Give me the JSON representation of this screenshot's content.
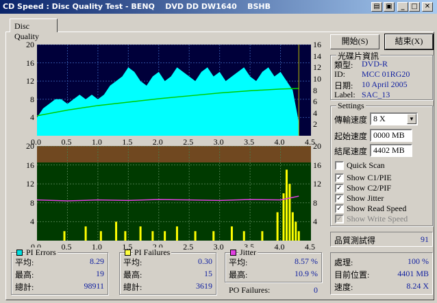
{
  "window": {
    "title": "CD Speed : Disc Quality Test - BENQ    DVD DD DW1640    BSHB"
  },
  "tab": {
    "label": "Disc Quality"
  },
  "buttons": {
    "start": "開始(S)",
    "stop": "結束(X)"
  },
  "disc_info": {
    "title": "光碟片資訊",
    "type_label": "類型:",
    "type_value": "DVD-R",
    "id_label": "ID:",
    "id_value": "MCC 01RG20",
    "date_label": "日期:",
    "date_value": "10 April 2005",
    "label_label": "Label:",
    "label_value": "SAC_13"
  },
  "settings": {
    "title": "Settings",
    "speed_label": "傳輸速度",
    "speed_value": "8 X",
    "start_label": "起始速度",
    "start_value": "0000 MB",
    "end_label": "結尾速度",
    "end_value": "4402 MB",
    "quick_scan": "Quick Scan",
    "show_c1": "Show C1/PIE",
    "show_c2": "Show C2/PIF",
    "show_jitter": "Show Jitter",
    "show_read": "Show Read Speed",
    "show_write": "Show Write Speed"
  },
  "quality": {
    "label": "品質測試得",
    "score": "91"
  },
  "progress": {
    "proc_label": "處理:",
    "proc_value": "100 %",
    "pos_label": "目前位置:",
    "pos_value": "4401 MB",
    "speed_label": "速度:",
    "speed_value": "8.24 X"
  },
  "pi_errors": {
    "title": "PI Errors",
    "avg_label": "平均:",
    "avg": "8.29",
    "max_label": "最高:",
    "max": "19",
    "total_label": "總計:",
    "total": "98911",
    "color": "#00e0e0"
  },
  "pi_failures": {
    "title": "PI Failures",
    "avg_label": "平均:",
    "avg": "0.30",
    "max_label": "最高:",
    "max": "15",
    "total_label": "總計:",
    "total": "3619",
    "color": "#ffff40"
  },
  "jitter": {
    "title": "Jitter",
    "avg_label": "平均:",
    "avg": "8.57 %",
    "max_label": "最高:",
    "max": "10.9 %",
    "color": "#e040e0"
  },
  "po_failures": {
    "label": "PO Failures:",
    "value": "0"
  },
  "chart_data": [
    {
      "type": "area",
      "xlim": [
        0,
        4.5
      ],
      "ylim": [
        0,
        20
      ],
      "y2lim": [
        0,
        16
      ],
      "xticks": [
        "0.0",
        "0.5",
        "1.0",
        "1.5",
        "2.0",
        "2.5",
        "3.0",
        "3.5",
        "4.0",
        "4.5"
      ],
      "yticks": [
        "4",
        "8",
        "12",
        "16",
        "20"
      ],
      "y2ticks": [
        "2",
        "4",
        "6",
        "8",
        "10",
        "12",
        "14",
        "16"
      ],
      "series": [
        {
          "name": "PI Errors",
          "color": "#00ffff",
          "x": [
            0.0,
            0.1,
            0.2,
            0.3,
            0.4,
            0.5,
            0.6,
            0.7,
            0.8,
            0.9,
            1.0,
            1.1,
            1.2,
            1.3,
            1.4,
            1.5,
            1.6,
            1.7,
            1.8,
            1.9,
            2.0,
            2.1,
            2.2,
            2.3,
            2.4,
            2.5,
            2.6,
            2.7,
            2.8,
            2.9,
            3.0,
            3.1,
            3.2,
            3.3,
            3.4,
            3.5,
            3.6,
            3.7,
            3.8,
            3.9,
            4.0,
            4.1,
            4.2,
            4.3
          ],
          "y": [
            4,
            6,
            7,
            8,
            8,
            7,
            8,
            9,
            8,
            9,
            8,
            9,
            11,
            12,
            13,
            15,
            14,
            12,
            11,
            13,
            14,
            12,
            13,
            15,
            14,
            13,
            12,
            14,
            15,
            13,
            14,
            12,
            13,
            14,
            15,
            13,
            12,
            14,
            15,
            13,
            14,
            12,
            10,
            3
          ]
        },
        {
          "name": "Read Speed",
          "color": "#00cc00",
          "x": [
            0.0,
            0.5,
            1.0,
            1.5,
            2.0,
            2.5,
            3.0,
            3.5,
            4.0,
            4.3
          ],
          "y": [
            3.5,
            4.5,
            5.3,
            5.9,
            6.5,
            7.0,
            7.5,
            7.9,
            8.2,
            8.3
          ]
        }
      ]
    },
    {
      "type": "bar",
      "xlim": [
        0,
        4.5
      ],
      "ylim": [
        0,
        20
      ],
      "xticks": [
        "0.0",
        "0.5",
        "1.0",
        "1.5",
        "2.0",
        "2.5",
        "3.0",
        "3.5",
        "4.0",
        "4.5"
      ],
      "yticks": [
        "4",
        "8",
        "12",
        "16",
        "20"
      ],
      "series": [
        {
          "name": "PI Failures",
          "color": "#ffff00",
          "x": [
            0.45,
            0.8,
            1.05,
            1.3,
            1.45,
            1.7,
            1.9,
            2.1,
            2.3,
            2.6,
            2.9,
            3.2,
            3.4,
            3.7,
            3.95,
            4.05,
            4.1,
            4.15,
            4.2,
            4.25,
            4.3
          ],
          "y": [
            2,
            3,
            2,
            4,
            2,
            3,
            2,
            2,
            3,
            2,
            2,
            3,
            2,
            2,
            6,
            10,
            15,
            12,
            6,
            4,
            2
          ]
        },
        {
          "name": "Jitter",
          "color": "#e040e0",
          "x": [
            0.0,
            0.5,
            1.0,
            1.5,
            2.0,
            2.5,
            3.0,
            3.5,
            4.0,
            4.3
          ],
          "y": [
            8.6,
            8.4,
            8.6,
            8.5,
            8.7,
            8.6,
            8.5,
            8.7,
            8.6,
            9.4
          ]
        }
      ]
    }
  ]
}
